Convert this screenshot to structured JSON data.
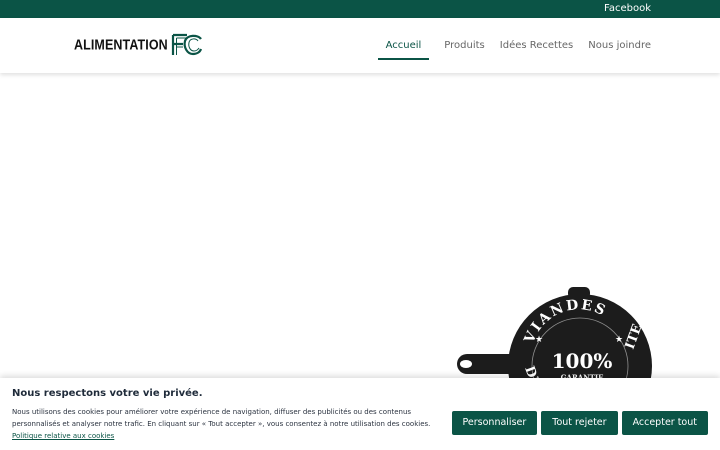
{
  "topbar": {
    "facebook_label": "Facebook"
  },
  "header": {
    "logo_text": "ALIMENTATION",
    "nav": [
      {
        "label": "Accueil",
        "active": true
      },
      {
        "label": "Produits"
      },
      {
        "label": "Idées Recettes"
      },
      {
        "label": "Nous joindre"
      }
    ]
  },
  "badge": {
    "arc_text": "VIANDES",
    "left_letters": "DE",
    "right_letters": "ITE",
    "percent": "100%",
    "guarantee": "GARANTIE"
  },
  "cookie": {
    "title": "Nous respectons votre vie privée.",
    "text": "Nous utilisons des cookies pour améliorer votre expérience de navigation, diffuser des publicités ou des contenus personnalisés et analyser notre trafic. En cliquant sur « Tout accepter », vous consentez à notre utilisation des cookies.",
    "policy_link": "Politique relative aux cookies",
    "buttons": {
      "customize": "Personnaliser",
      "reject": "Tout rejeter",
      "accept": "Accepter tout"
    }
  },
  "colors": {
    "brand": "#0b5446",
    "badge": "#1c1c1c"
  }
}
